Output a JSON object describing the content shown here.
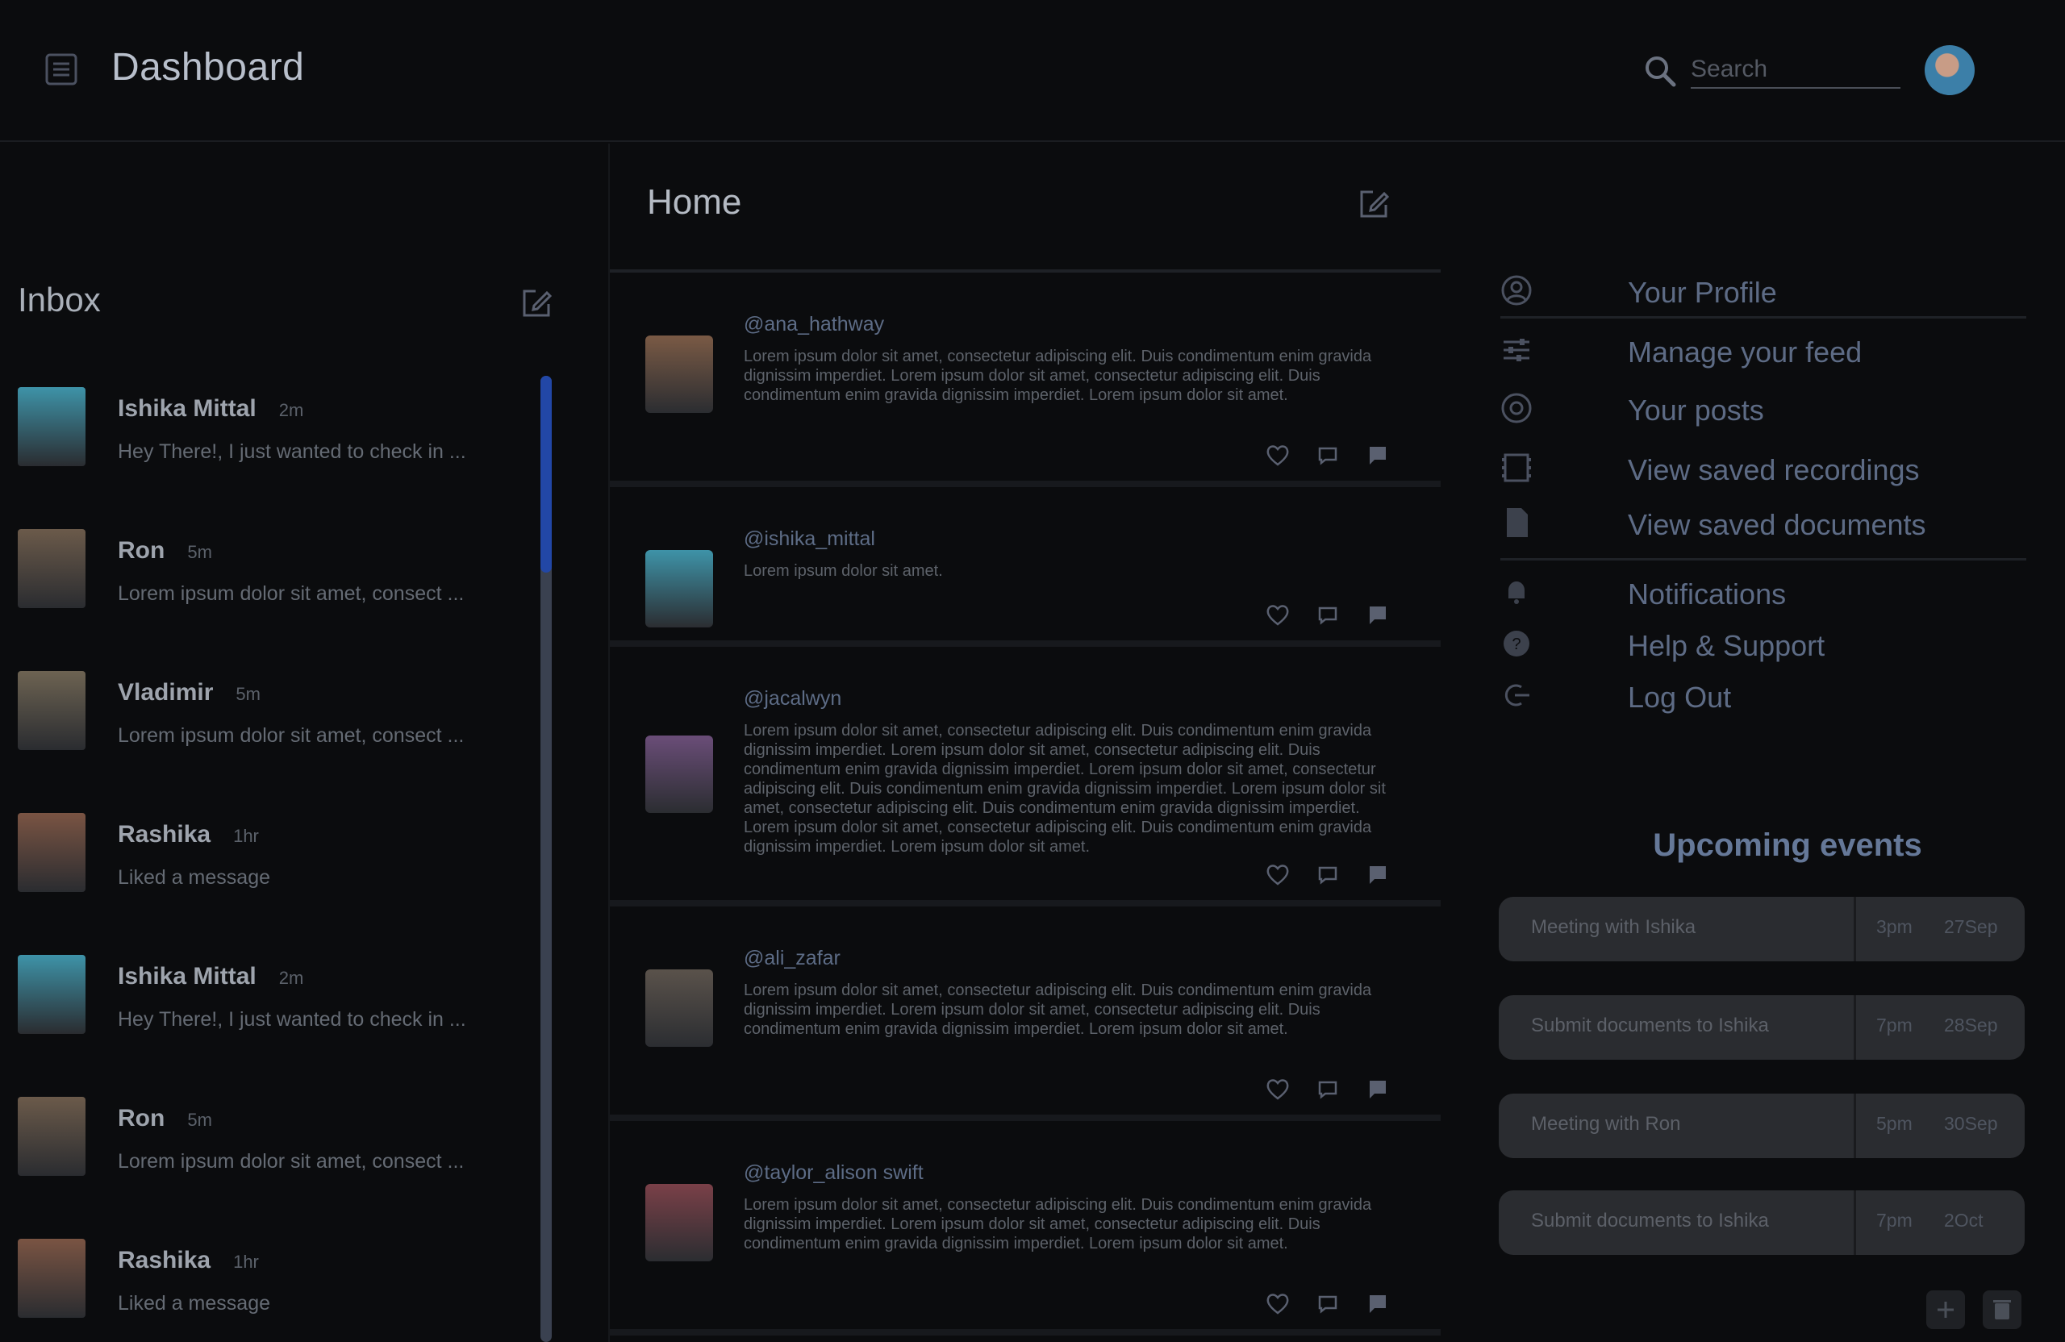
{
  "header": {
    "title": "Dashboard",
    "search_placeholder": "Search",
    "icons": [
      "menu-icon",
      "search-icon",
      "avatar"
    ]
  },
  "inbox": {
    "title": "Inbox",
    "messages": [
      {
        "name": "Ishika Mittal",
        "time": "2m",
        "preview": "Hey There!, I just wanted to check in ...",
        "avatar_color": "#3e93a8"
      },
      {
        "name": "Ron",
        "time": "5m",
        "preview": "Lorem ipsum dolor sit amet, consect ...",
        "avatar_color": "#6b5a4a"
      },
      {
        "name": "Vladimir",
        "time": "5m",
        "preview": "Lorem ipsum dolor sit amet, consect ...",
        "avatar_color": "#6d6352"
      },
      {
        "name": "Rashika",
        "time": "1hr",
        "preview": "Liked a message",
        "avatar_color": "#7a5443"
      },
      {
        "name": "Ishika Mittal",
        "time": "2m",
        "preview": "Hey There!, I just wanted to check in ...",
        "avatar_color": "#3e93a8"
      },
      {
        "name": "Ron",
        "time": "5m",
        "preview": "Lorem ipsum dolor sit amet, consect ...",
        "avatar_color": "#6b5a4a"
      },
      {
        "name": "Rashika",
        "time": "1hr",
        "preview": "Liked a message",
        "avatar_color": "#7a5443"
      }
    ]
  },
  "feed": {
    "title": "Home",
    "posts": [
      {
        "handle": "@ana_hathway",
        "text": "Lorem ipsum dolor sit amet, consectetur adipiscing elit. Duis condimentum enim gravida dignissim imperdiet. Lorem ipsum dolor sit amet, consectetur adipiscing elit. Duis condimentum enim gravida dignissim imperdiet. Lorem ipsum dolor sit amet.",
        "avatar_color": "#7a5a45"
      },
      {
        "handle": "@ishika_mittal",
        "text": "Lorem ipsum dolor sit amet.",
        "avatar_color": "#3e93a8"
      },
      {
        "handle": "@jacalwyn",
        "text": "Lorem ipsum dolor sit amet, consectetur adipiscing elit. Duis condimentum enim gravida dignissim imperdiet. Lorem ipsum dolor sit amet, consectetur adipiscing elit. Duis condimentum enim gravida dignissim imperdiet. Lorem ipsum dolor sit amet, consectetur adipiscing elit. Duis condimentum enim gravida dignissim imperdiet. Lorem ipsum dolor sit amet, consectetur adipiscing elit. Duis condimentum enim gravida dignissim imperdiet. Lorem ipsum dolor sit amet, consectetur adipiscing elit. Duis condimentum enim gravida dignissim imperdiet. Lorem ipsum dolor sit amet.",
        "avatar_color": "#6a4d78"
      },
      {
        "handle": "@ali_zafar",
        "text": "Lorem ipsum dolor sit amet, consectetur adipiscing elit. Duis condimentum enim gravida dignissim imperdiet. Lorem ipsum dolor sit amet, consectetur adipiscing elit. Duis condimentum enim gravida dignissim imperdiet. Lorem ipsum dolor sit amet.",
        "avatar_color": "#5a524b"
      },
      {
        "handle": "@taylor_alison swift",
        "text": "Lorem ipsum dolor sit amet, consectetur adipiscing elit. Duis condimentum enim gravida dignissim imperdiet. Lorem ipsum dolor sit amet, consectetur adipiscing elit. Duis condimentum enim gravida dignissim imperdiet. Lorem ipsum dolor sit amet.",
        "avatar_color": "#7a4048"
      }
    ]
  },
  "sidebar": {
    "items": [
      {
        "label": "Your Profile",
        "icon": "user-circle-icon"
      },
      {
        "label": "Manage your feed",
        "icon": "sliders-icon"
      },
      {
        "label": "Your posts",
        "icon": "at-icon"
      },
      {
        "label": "View saved recordings",
        "icon": "film-icon"
      },
      {
        "label": "View saved documents",
        "icon": "document-icon"
      },
      {
        "label": "Notifications",
        "icon": "bell-icon"
      },
      {
        "label": "Help & Support",
        "icon": "help-icon"
      },
      {
        "label": "Log Out",
        "icon": "logout-icon"
      }
    ]
  },
  "events": {
    "title": "Upcoming events",
    "items": [
      {
        "title": "Meeting with Ishika",
        "time": "3pm",
        "date": "27Sep"
      },
      {
        "title": "Submit documents to Ishika",
        "time": "7pm",
        "date": "28Sep"
      },
      {
        "title": "Meeting with Ron",
        "time": "5pm",
        "date": "30Sep"
      },
      {
        "title": "Submit documents to Ishika",
        "time": "7pm",
        "date": "2Oct"
      }
    ]
  },
  "colors": {
    "background": "#0b0c0e",
    "accent": "#2247a6",
    "link": "#5d6b85"
  }
}
